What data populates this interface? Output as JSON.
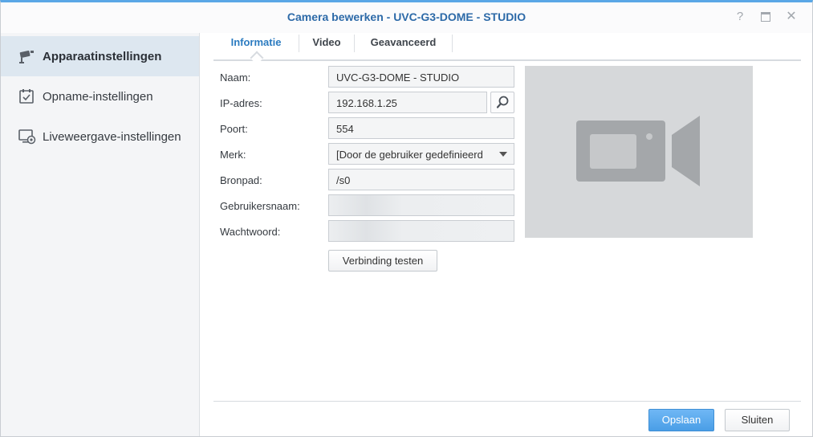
{
  "window": {
    "title": "Camera bewerken - UVC-G3-DOME - STUDIO",
    "help_glyph": "?",
    "close_glyph": "✕"
  },
  "sidebar": {
    "items": [
      {
        "label": "Apparaatinstellingen",
        "icon": "camera-settings-icon",
        "active": true
      },
      {
        "label": "Opname-instellingen",
        "icon": "calendar-check-icon",
        "active": false
      },
      {
        "label": "Liveweergave-instellingen",
        "icon": "monitor-eye-icon",
        "active": false
      }
    ]
  },
  "tabs": [
    {
      "label": "Informatie",
      "active": true
    },
    {
      "label": "Video",
      "active": false
    },
    {
      "label": "Geavanceerd",
      "active": false
    }
  ],
  "form": {
    "name": {
      "label": "Naam:",
      "value": "UVC-G3-DOME - STUDIO"
    },
    "ip": {
      "label": "IP-adres:",
      "value": "192.168.1.25"
    },
    "port": {
      "label": "Poort:",
      "value": "554"
    },
    "brand": {
      "label": "Merk:",
      "value": "[Door de gebruiker gedefinieerd"
    },
    "path": {
      "label": "Bronpad:",
      "value": "/s0"
    },
    "username": {
      "label": "Gebruikersnaam:",
      "value": ""
    },
    "password": {
      "label": "Wachtwoord:",
      "value": ""
    },
    "test_button": "Verbinding testen"
  },
  "preview": {
    "icon": "video-camera-icon"
  },
  "footer": {
    "save": "Opslaan",
    "close": "Sluiten"
  },
  "colors": {
    "accent": "#2b7bc0",
    "title": "#2d6aa8",
    "primary_button": "#4a9ee6",
    "sidebar_active": "#dde7f0",
    "preview_bg": "#d6d8da",
    "preview_icon": "#a4a7aa"
  }
}
